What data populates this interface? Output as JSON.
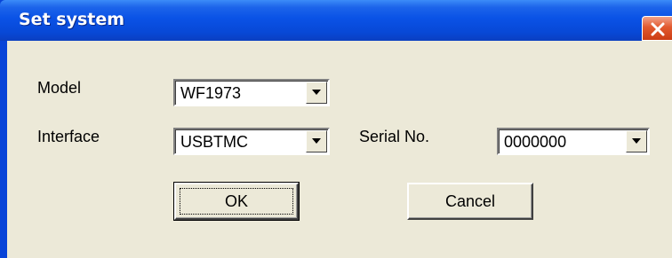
{
  "window": {
    "title": "Set system",
    "close_icon": "close-icon"
  },
  "form": {
    "model": {
      "label": "Model",
      "selected": "WF1973"
    },
    "interface": {
      "label": "Interface",
      "selected": "USBTMC"
    },
    "serial": {
      "label": "Serial No.",
      "selected": "0000000"
    }
  },
  "buttons": {
    "ok": "OK",
    "cancel": "Cancel"
  },
  "colors": {
    "titlebar": "#0a52e6",
    "client": "#ece9d8",
    "close": "#e2592e"
  }
}
